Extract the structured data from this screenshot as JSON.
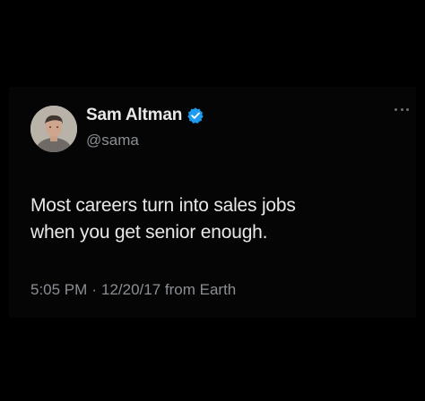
{
  "tweet": {
    "author": {
      "name": "Sam Altman",
      "handle": "@sama",
      "verified": true,
      "verified_color": "#1d9bf0"
    },
    "text": "Most careers turn into sales jobs\nwhen you get senior enough.",
    "time": "5:05 PM",
    "separator": "·",
    "date": "12/20/17",
    "source": "from Earth",
    "more_icon": "ellipsis-icon"
  },
  "colors": {
    "background": "#000000",
    "card": "#050505",
    "text": "#e9e9e9",
    "muted": "#8b8f94"
  }
}
